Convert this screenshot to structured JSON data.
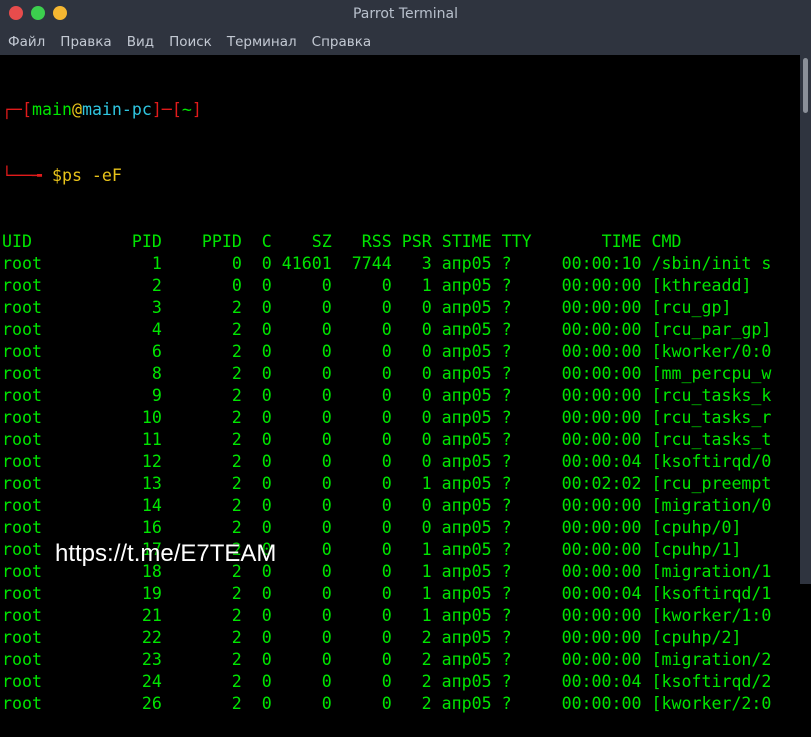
{
  "window": {
    "title": "Parrot Terminal",
    "buttons": {
      "close": "#e74c4c",
      "maximize": "#3ccf4e",
      "minimize": "#f5b731"
    }
  },
  "menu": [
    "Файл",
    "Правка",
    "Вид",
    "Поиск",
    "Терминал",
    "Справка"
  ],
  "prompt": {
    "user": "main",
    "at": "@",
    "host": "main-pc",
    "dir": "~",
    "symbol": "$",
    "command": "ps -eF"
  },
  "table": {
    "headers": [
      "UID",
      "PID",
      "PPID",
      "C",
      "SZ",
      "RSS",
      "PSR",
      "STIME",
      "TTY",
      "TIME",
      "CMD"
    ],
    "rows": [
      [
        "root",
        "1",
        "0",
        "0",
        "41601",
        "7744",
        "3",
        "апр05",
        "?",
        "00:00:10",
        "/sbin/init s"
      ],
      [
        "root",
        "2",
        "0",
        "0",
        "0",
        "0",
        "1",
        "апр05",
        "?",
        "00:00:00",
        "[kthreadd]"
      ],
      [
        "root",
        "3",
        "2",
        "0",
        "0",
        "0",
        "0",
        "апр05",
        "?",
        "00:00:00",
        "[rcu_gp]"
      ],
      [
        "root",
        "4",
        "2",
        "0",
        "0",
        "0",
        "0",
        "апр05",
        "?",
        "00:00:00",
        "[rcu_par_gp]"
      ],
      [
        "root",
        "6",
        "2",
        "0",
        "0",
        "0",
        "0",
        "апр05",
        "?",
        "00:00:00",
        "[kworker/0:0"
      ],
      [
        "root",
        "8",
        "2",
        "0",
        "0",
        "0",
        "0",
        "апр05",
        "?",
        "00:00:00",
        "[mm_percpu_w"
      ],
      [
        "root",
        "9",
        "2",
        "0",
        "0",
        "0",
        "0",
        "апр05",
        "?",
        "00:00:00",
        "[rcu_tasks_k"
      ],
      [
        "root",
        "10",
        "2",
        "0",
        "0",
        "0",
        "0",
        "апр05",
        "?",
        "00:00:00",
        "[rcu_tasks_r"
      ],
      [
        "root",
        "11",
        "2",
        "0",
        "0",
        "0",
        "0",
        "апр05",
        "?",
        "00:00:00",
        "[rcu_tasks_t"
      ],
      [
        "root",
        "12",
        "2",
        "0",
        "0",
        "0",
        "0",
        "апр05",
        "?",
        "00:00:04",
        "[ksoftirqd/0"
      ],
      [
        "root",
        "13",
        "2",
        "0",
        "0",
        "0",
        "1",
        "апр05",
        "?",
        "00:02:02",
        "[rcu_preempt"
      ],
      [
        "root",
        "14",
        "2",
        "0",
        "0",
        "0",
        "0",
        "апр05",
        "?",
        "00:00:00",
        "[migration/0"
      ],
      [
        "root",
        "16",
        "2",
        "0",
        "0",
        "0",
        "0",
        "апр05",
        "?",
        "00:00:00",
        "[cpuhp/0]"
      ],
      [
        "root",
        "17",
        "2",
        "0",
        "0",
        "0",
        "1",
        "апр05",
        "?",
        "00:00:00",
        "[cpuhp/1]"
      ],
      [
        "root",
        "18",
        "2",
        "0",
        "0",
        "0",
        "1",
        "апр05",
        "?",
        "00:00:00",
        "[migration/1"
      ],
      [
        "root",
        "19",
        "2",
        "0",
        "0",
        "0",
        "1",
        "апр05",
        "?",
        "00:00:04",
        "[ksoftirqd/1"
      ],
      [
        "root",
        "21",
        "2",
        "0",
        "0",
        "0",
        "1",
        "апр05",
        "?",
        "00:00:00",
        "[kworker/1:0"
      ],
      [
        "root",
        "22",
        "2",
        "0",
        "0",
        "0",
        "2",
        "апр05",
        "?",
        "00:00:00",
        "[cpuhp/2]"
      ],
      [
        "root",
        "23",
        "2",
        "0",
        "0",
        "0",
        "2",
        "апр05",
        "?",
        "00:00:00",
        "[migration/2"
      ],
      [
        "root",
        "24",
        "2",
        "0",
        "0",
        "0",
        "2",
        "апр05",
        "?",
        "00:00:04",
        "[ksoftirqd/2"
      ],
      [
        "root",
        "26",
        "2",
        "0",
        "0",
        "0",
        "2",
        "апр05",
        "?",
        "00:00:00",
        "[kworker/2:0"
      ]
    ]
  },
  "watermark": "https://t.me/E7TEAM"
}
